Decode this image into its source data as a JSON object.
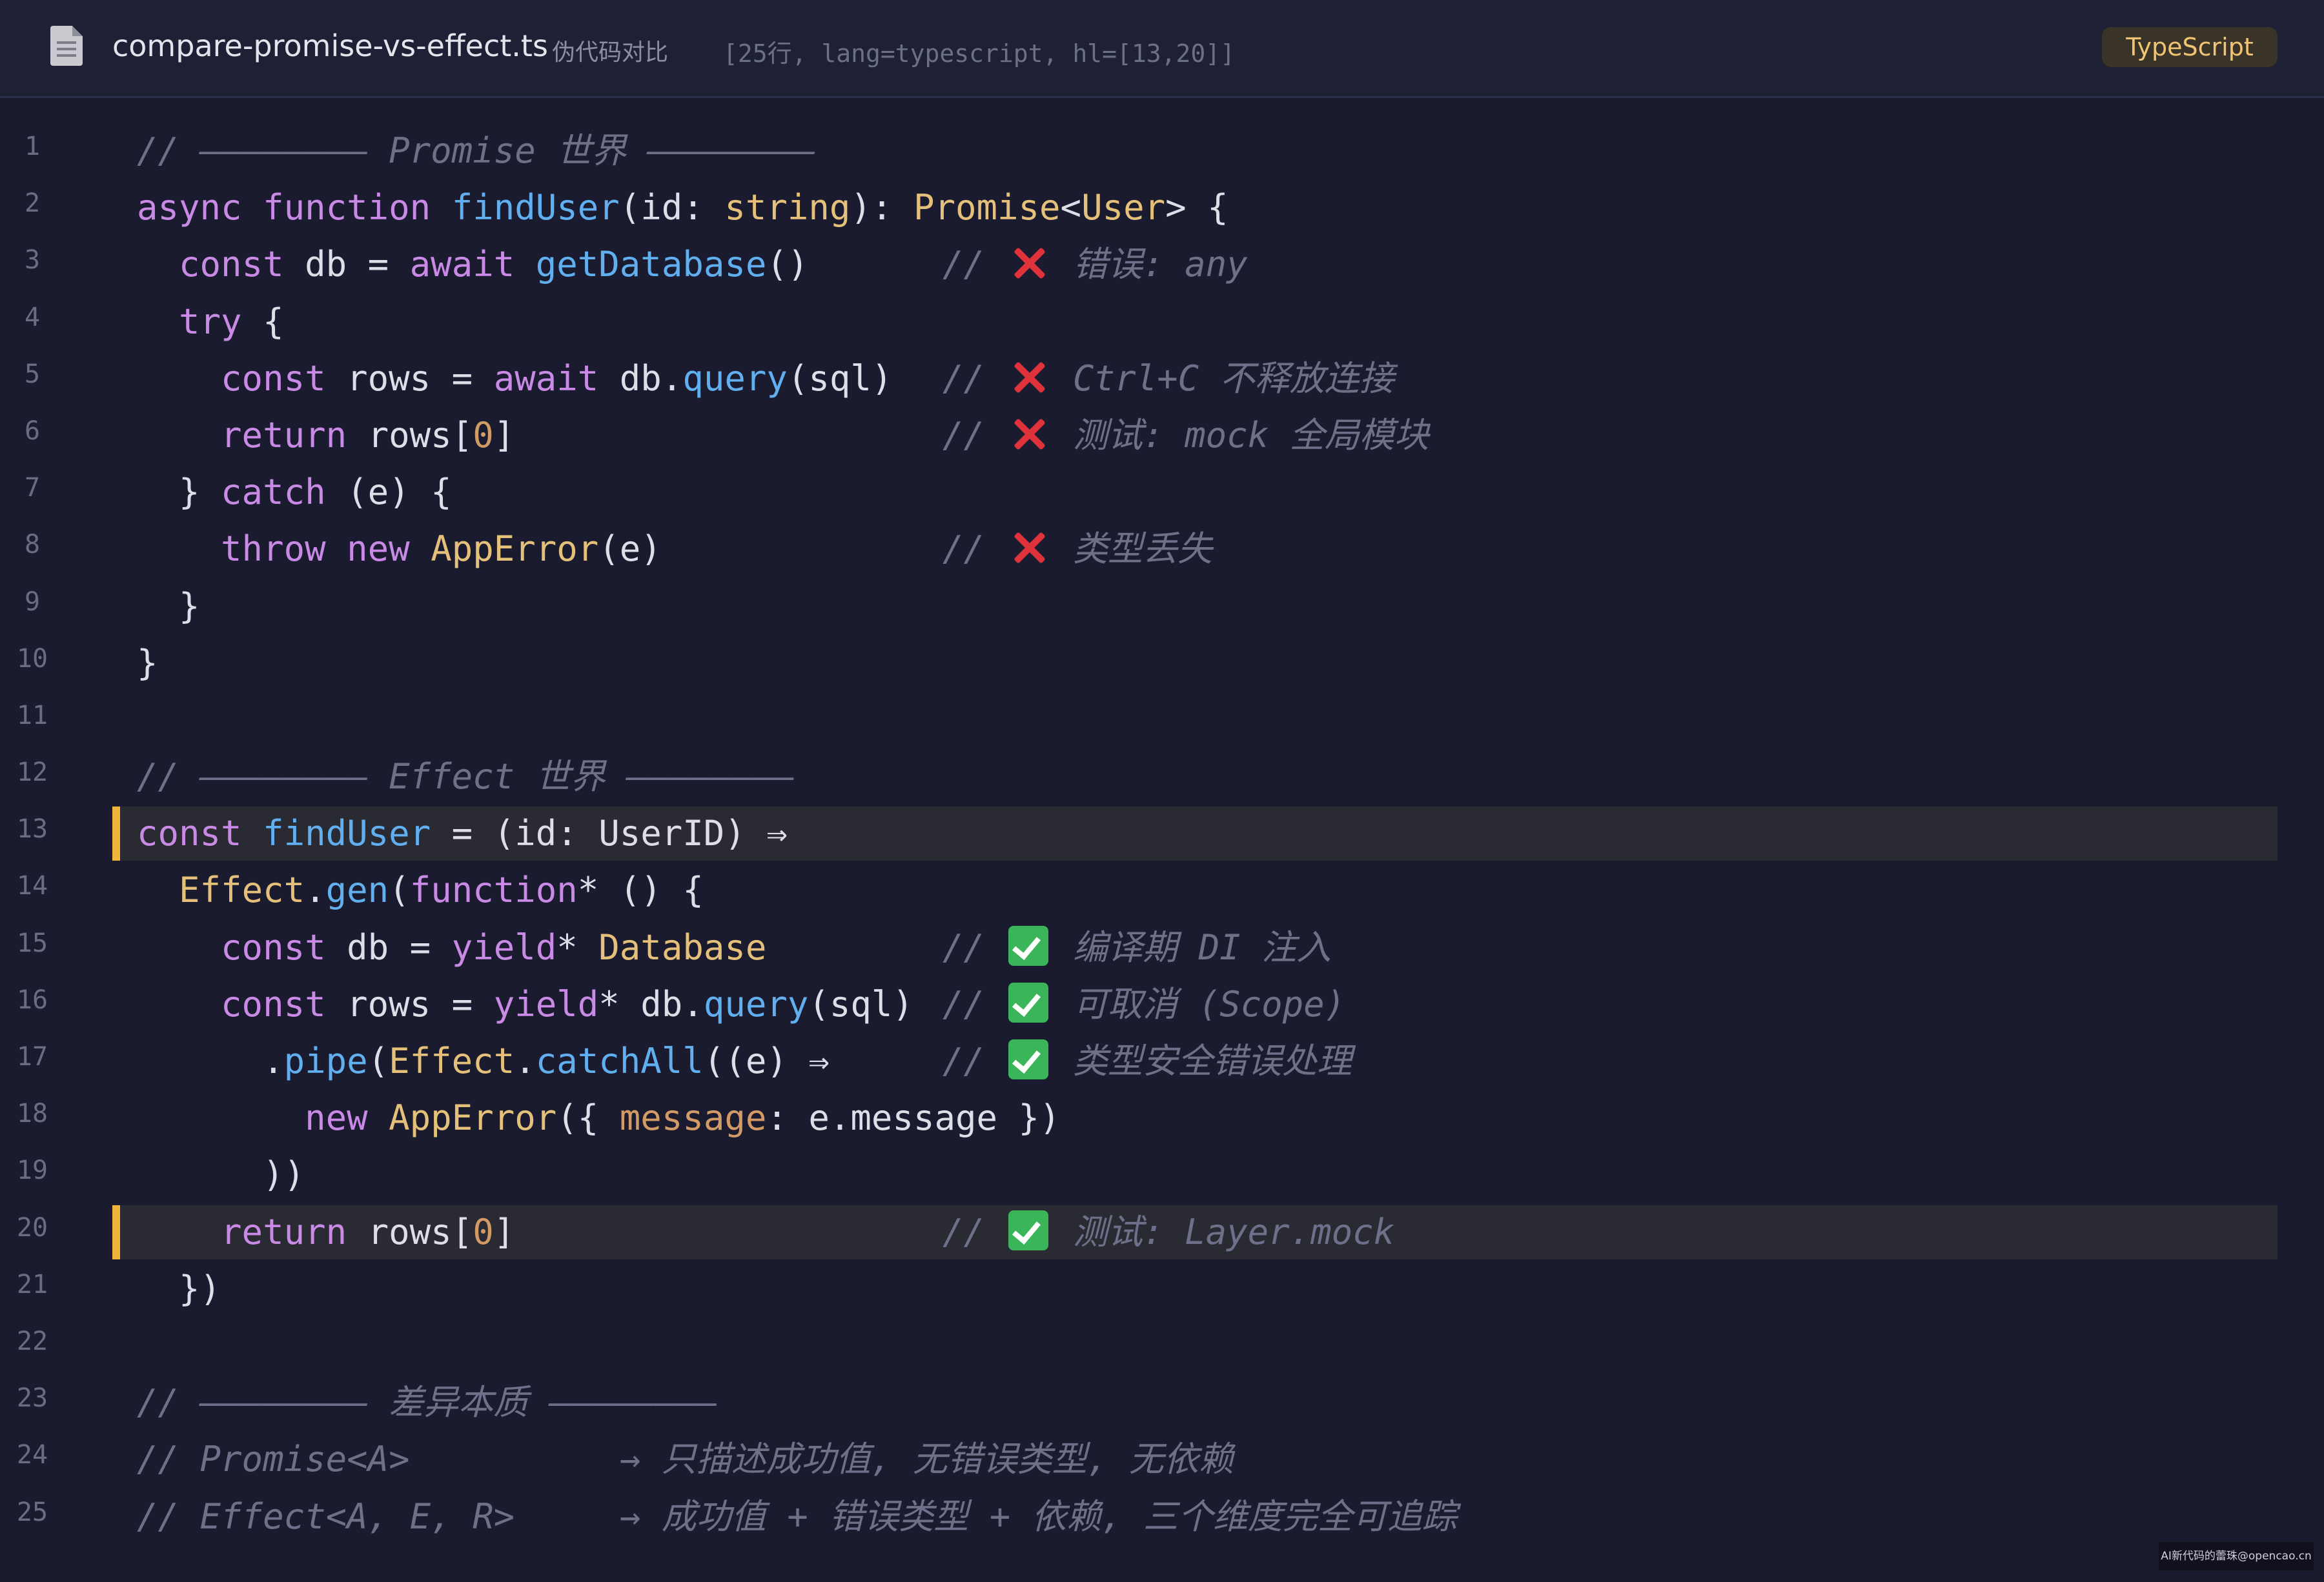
{
  "window": {
    "icon": "document-icon",
    "file_name": "compare-promise-vs-effect.ts",
    "subtitle": "伪代码对比",
    "meta": "[25行, lang=typescript, hl=[13,20]]",
    "language_badge": "TypeScript"
  },
  "colors": {
    "background": "#1a1b2e",
    "keyword": "#c98ae6",
    "function": "#61afef",
    "type": "#e5c07b",
    "number": "#d19a66",
    "comment": "#6e708a",
    "highlight_bar": "#f0b43c"
  },
  "highlighted_lines": [
    13,
    20
  ],
  "lines": [
    {
      "n": "1",
      "tokens": [
        [
          "cm",
          "// ———————— Promise 世界 ————————"
        ]
      ]
    },
    {
      "n": "2",
      "tokens": [
        [
          "kw",
          "async"
        ],
        [
          "pl",
          " "
        ],
        [
          "kw",
          "function"
        ],
        [
          "pl",
          " "
        ],
        [
          "fn",
          "findUser"
        ],
        [
          "pl",
          "(id: "
        ],
        [
          "ty",
          "string"
        ],
        [
          "pl",
          "): "
        ],
        [
          "ty",
          "Promise"
        ],
        [
          "pl",
          "<"
        ],
        [
          "ty",
          "User"
        ],
        [
          "pl",
          "> {"
        ]
      ]
    },
    {
      "n": "3",
      "tokens": [
        [
          "pl",
          "  "
        ],
        [
          "kw",
          "const"
        ],
        [
          "pl",
          " db = "
        ],
        [
          "kw",
          "await"
        ],
        [
          "pl",
          " "
        ],
        [
          "fn",
          "getDatabase"
        ],
        [
          "pl",
          "()"
        ]
      ],
      "mark": "x",
      "comment": "错误: any"
    },
    {
      "n": "4",
      "tokens": [
        [
          "pl",
          "  "
        ],
        [
          "kw",
          "try"
        ],
        [
          "pl",
          " {"
        ]
      ]
    },
    {
      "n": "5",
      "tokens": [
        [
          "pl",
          "    "
        ],
        [
          "kw",
          "const"
        ],
        [
          "pl",
          " rows = "
        ],
        [
          "kw",
          "await"
        ],
        [
          "pl",
          " db."
        ],
        [
          "fn",
          "query"
        ],
        [
          "pl",
          "(sql)"
        ]
      ],
      "mark": "x",
      "comment": "Ctrl+C 不释放连接"
    },
    {
      "n": "6",
      "tokens": [
        [
          "pl",
          "    "
        ],
        [
          "kw",
          "return"
        ],
        [
          "pl",
          " rows["
        ],
        [
          "num",
          "0"
        ],
        [
          "pl",
          "]"
        ]
      ],
      "mark": "x",
      "comment": "测试: mock 全局模块"
    },
    {
      "n": "7",
      "tokens": [
        [
          "pl",
          "  } "
        ],
        [
          "kw",
          "catch"
        ],
        [
          "pl",
          " (e) {"
        ]
      ]
    },
    {
      "n": "8",
      "tokens": [
        [
          "pl",
          "    "
        ],
        [
          "kw",
          "throw"
        ],
        [
          "pl",
          " "
        ],
        [
          "kw",
          "new"
        ],
        [
          "pl",
          " "
        ],
        [
          "ty",
          "AppError"
        ],
        [
          "pl",
          "(e)"
        ]
      ],
      "mark": "x",
      "comment": "类型丢失"
    },
    {
      "n": "9",
      "tokens": [
        [
          "pl",
          "  }"
        ]
      ]
    },
    {
      "n": "10",
      "tokens": [
        [
          "pl",
          "}"
        ]
      ]
    },
    {
      "n": "11",
      "tokens": []
    },
    {
      "n": "12",
      "tokens": [
        [
          "cm",
          "// ———————— Effect 世界 ————————"
        ]
      ]
    },
    {
      "n": "13",
      "tokens": [
        [
          "kw",
          "const"
        ],
        [
          "pl",
          " "
        ],
        [
          "fn",
          "findUser"
        ],
        [
          "pl",
          " = (id: UserID) ⇒"
        ]
      ]
    },
    {
      "n": "14",
      "tokens": [
        [
          "pl",
          "  "
        ],
        [
          "ty",
          "Effect"
        ],
        [
          "pl",
          "."
        ],
        [
          "fn",
          "gen"
        ],
        [
          "pl",
          "("
        ],
        [
          "kw",
          "function"
        ],
        [
          "pl",
          "* () {"
        ]
      ]
    },
    {
      "n": "15",
      "tokens": [
        [
          "pl",
          "    "
        ],
        [
          "kw",
          "const"
        ],
        [
          "pl",
          " db = "
        ],
        [
          "kw",
          "yield"
        ],
        [
          "pl",
          "* "
        ],
        [
          "ty",
          "Database"
        ]
      ],
      "mark": "ok",
      "comment": "编译期 DI 注入"
    },
    {
      "n": "16",
      "tokens": [
        [
          "pl",
          "    "
        ],
        [
          "kw",
          "const"
        ],
        [
          "pl",
          " rows = "
        ],
        [
          "kw",
          "yield"
        ],
        [
          "pl",
          "* db."
        ],
        [
          "fn",
          "query"
        ],
        [
          "pl",
          "(sql)"
        ]
      ],
      "mark": "ok",
      "comment": "可取消 (Scope)"
    },
    {
      "n": "17",
      "tokens": [
        [
          "pl",
          "      ."
        ],
        [
          "fn",
          "pipe"
        ],
        [
          "pl",
          "("
        ],
        [
          "ty",
          "Effect"
        ],
        [
          "pl",
          "."
        ],
        [
          "fn",
          "catchAll"
        ],
        [
          "pl",
          "((e) ⇒"
        ]
      ],
      "mark": "ok",
      "comment": "类型安全错误处理"
    },
    {
      "n": "18",
      "tokens": [
        [
          "pl",
          "        "
        ],
        [
          "kw",
          "new"
        ],
        [
          "pl",
          " "
        ],
        [
          "ty",
          "AppError"
        ],
        [
          "pl",
          "({ "
        ],
        [
          "prop",
          "message"
        ],
        [
          "pl",
          ": e.message })"
        ]
      ]
    },
    {
      "n": "19",
      "tokens": [
        [
          "pl",
          "      ))"
        ]
      ]
    },
    {
      "n": "20",
      "tokens": [
        [
          "pl",
          "    "
        ],
        [
          "kw",
          "return"
        ],
        [
          "pl",
          " rows["
        ],
        [
          "num",
          "0"
        ],
        [
          "pl",
          "]"
        ]
      ],
      "mark": "ok",
      "comment": "测试: Layer.mock"
    },
    {
      "n": "21",
      "tokens": [
        [
          "pl",
          "  })"
        ]
      ]
    },
    {
      "n": "22",
      "tokens": []
    },
    {
      "n": "23",
      "tokens": [
        [
          "cm",
          "// ———————— 差异本质 ————————"
        ]
      ]
    },
    {
      "n": "24",
      "tokens": [
        [
          "cm",
          "// Promise<A>          → 只描述成功值, 无错误类型, 无依赖"
        ]
      ]
    },
    {
      "n": "25",
      "tokens": [
        [
          "cm",
          "// Effect<A, E, R>     → 成功值 + 错误类型 + 依赖, 三个维度完全可追踪"
        ]
      ]
    }
  ],
  "watermark": "AI新代码的蕾珠@opencao.cn"
}
